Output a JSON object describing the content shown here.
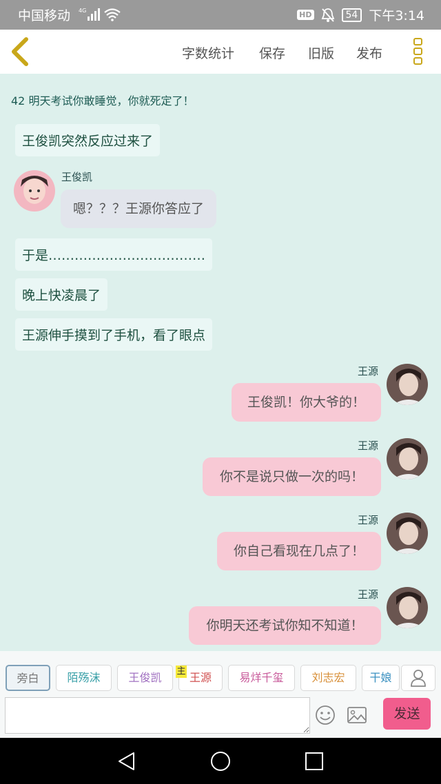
{
  "status_bar": {
    "carrier": "中国移动",
    "network": "4G",
    "battery": "54",
    "time": "下午3:14",
    "hd_label": "HD"
  },
  "header": {
    "menu": [
      "字数统计",
      "保存",
      "旧版",
      "发布"
    ],
    "accent_color": "#c9a71a"
  },
  "chat": {
    "title": "42 明天考试你敢睡觉，你就死定了！",
    "narrations": [
      "王俊凯突然反应过来了",
      "于是………………………………",
      "晚上快凌晨了",
      "王源伸手摸到了手机，看了眼点"
    ],
    "left_message": {
      "speaker": "王俊凯",
      "text": "嗯？？？王源你答应了"
    },
    "right_messages": [
      {
        "speaker": "王源",
        "text": "王俊凯！你大爷的！"
      },
      {
        "speaker": "王源",
        "text": "你不是说只做一次的吗！"
      },
      {
        "speaker": "王源",
        "text": "你自己看现在几点了！"
      },
      {
        "speaker": "王源",
        "text": "你明天还考试你知不知道！"
      }
    ]
  },
  "roles": {
    "items": [
      "旁白",
      "陌殇沫",
      "王俊凯",
      "王源",
      "易烊千玺",
      "刘志宏",
      "干娘"
    ],
    "colors": [
      "#777777",
      "#3aa0a8",
      "#a070c0",
      "#d05050",
      "#c85a9a",
      "#d8903a",
      "#3a90c0"
    ],
    "host_badge": "主"
  },
  "input": {
    "placeholder": "",
    "send_label": "发送"
  },
  "colors": {
    "background": "#ddf0ec",
    "bubble_right": "#f8c9d5",
    "send_button": "#f15d8d"
  }
}
